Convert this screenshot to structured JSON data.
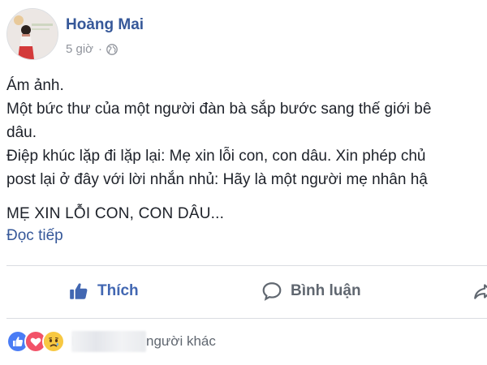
{
  "post": {
    "author": "Hoàng Mai",
    "timestamp": "5 giờ",
    "separator": "·",
    "privacy_icon": "globe-icon",
    "lines": [
      "Ám ảnh.",
      "Một bức thư của một người đàn bà sắp bước sang thế giới bê",
      "dâu.",
      "Điệp khúc lặp đi lặp lại: Mẹ xin lỗi con, con dâu. Xin phép chủ",
      "post lại ở đây với lời nhắn nhủ: Hãy là một người mẹ nhân hậ"
    ],
    "headline": "MẸ XIN LỖI CON, CON DÂU...",
    "see_more": "Đọc tiếp"
  },
  "actions": {
    "like_label": "Thích",
    "comment_label": "Bình luận"
  },
  "reactions": {
    "icons": [
      "like-reaction-icon",
      "love-reaction-icon",
      "sad-reaction-icon"
    ],
    "leading_char": "I",
    "others_text": "người khác"
  },
  "colors": {
    "link": "#365899",
    "like_active": "#4267b2",
    "muted": "#90949c",
    "text": "#1d2129",
    "love": "#f25268"
  }
}
